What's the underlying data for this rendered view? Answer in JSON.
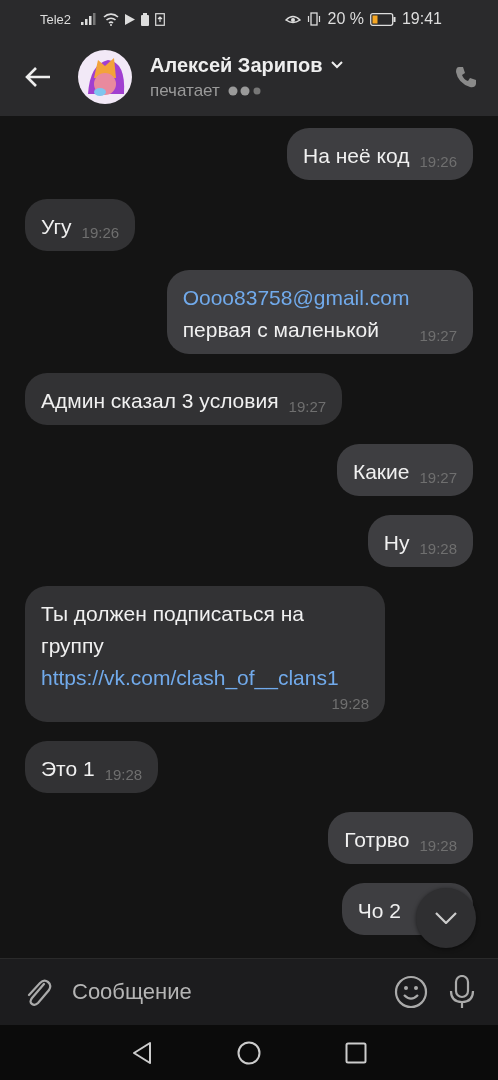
{
  "status_bar": {
    "carrier": "Tele2",
    "battery": "20 %",
    "time": "19:41"
  },
  "header": {
    "name": "Алексей Зарипов",
    "status": "печатает"
  },
  "messages": [
    {
      "outgoing": true,
      "parts": [
        {
          "kind": "text",
          "text": "На неё код"
        }
      ],
      "time": "19:26"
    },
    {
      "outgoing": false,
      "parts": [
        {
          "kind": "text",
          "text": "Угу"
        }
      ],
      "time": "19:26"
    },
    {
      "outgoing": true,
      "parts": [
        {
          "kind": "link",
          "text": "Oooo83758@gmail.com"
        },
        {
          "kind": "text",
          "text": "первая с маленькой"
        }
      ],
      "time": "19:27"
    },
    {
      "outgoing": false,
      "parts": [
        {
          "kind": "text",
          "text": "Админ сказал 3 условия"
        }
      ],
      "time": "19:27"
    },
    {
      "outgoing": true,
      "parts": [
        {
          "kind": "text",
          "text": "Какие"
        }
      ],
      "time": "19:27"
    },
    {
      "outgoing": true,
      "parts": [
        {
          "kind": "text",
          "text": "Ну"
        }
      ],
      "time": "19:28"
    },
    {
      "outgoing": false,
      "parts": [
        {
          "kind": "text",
          "text": "Ты должен подписаться на группу"
        },
        {
          "kind": "link",
          "text": "https://vk.com/clash_of__clans1"
        }
      ],
      "time": "19:28"
    },
    {
      "outgoing": false,
      "parts": [
        {
          "kind": "text",
          "text": "Это 1"
        }
      ],
      "time": "19:28"
    },
    {
      "outgoing": true,
      "parts": [
        {
          "kind": "text",
          "text": "Готрво"
        }
      ],
      "time": "19:28"
    },
    {
      "outgoing": true,
      "parts": [
        {
          "kind": "text",
          "text": "Чо 2"
        }
      ]
    }
  ],
  "composer": {
    "placeholder": "Сообщение"
  }
}
